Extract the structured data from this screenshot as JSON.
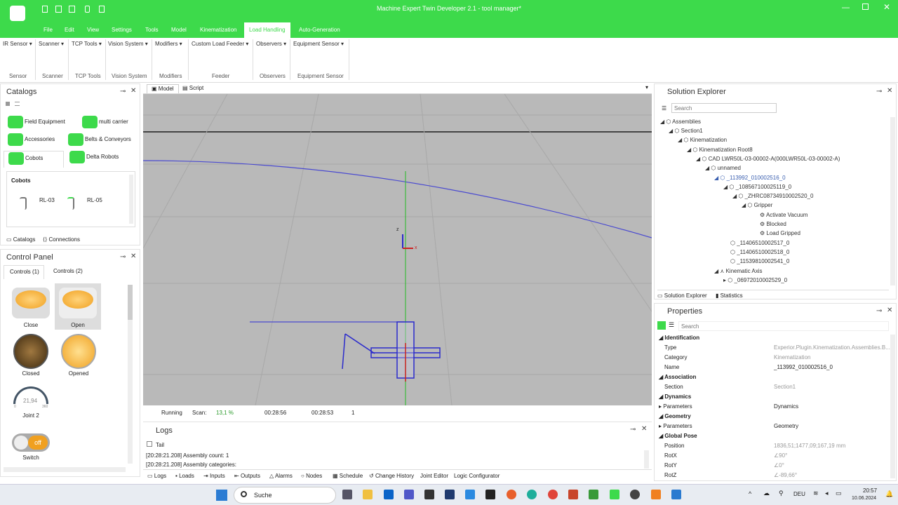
{
  "window": {
    "title": "Machine Expert Twin Developer 2.1 - tool manager*"
  },
  "menu": [
    "File",
    "Edit",
    "View",
    "Settings",
    "Tools",
    "Model",
    "Kinematization",
    "Load Handling",
    "Auto-Generation"
  ],
  "ribbon": {
    "items": [
      "IR Sensor",
      "Scanner",
      "TCP Tools",
      "Vision System",
      "Modifiers",
      "Custom Load Feeder",
      "Observers",
      "Equipment Sensor"
    ],
    "groups": [
      "Sensor",
      "Scanner",
      "TCP Tools",
      "Vision System",
      "Modifiers",
      "Feeder",
      "Observers",
      "Equipment Sensor"
    ]
  },
  "catalogs": {
    "title": "Catalogs",
    "items": [
      "Field Equipment",
      "multi carrier",
      "Accessories",
      "Belts & Conveyors",
      "Cobots",
      "Delta Robots"
    ],
    "section": "Cobots",
    "cobots": [
      "RL-03",
      "RL-05"
    ],
    "tabs": [
      "Catalogs",
      "Connections"
    ]
  },
  "control_panel": {
    "title": "Control Panel",
    "tabs": [
      "Controls (1)",
      "Controls (2)"
    ],
    "controls": [
      "Close",
      "Open",
      "Closed",
      "Opened",
      "Joint 2",
      "Switch"
    ],
    "gauge_value": "21,94",
    "gauge_min": "0",
    "gauge_max": "360",
    "switch_text": "off"
  },
  "viewport": {
    "tabs": [
      "Model",
      "Script"
    ],
    "status": {
      "state": "Running",
      "scan_label": "Scan:",
      "scan_value": "13,1 %",
      "t1": "00:28:56",
      "t2": "00:28:53",
      "count": "1"
    },
    "axis_z": "z",
    "axis_x": "x"
  },
  "logs": {
    "title": "Logs",
    "tail": "Tail",
    "lines": [
      "[20:28:21.208] Assembly count: 1",
      "[20:28:21.208] Assembly categories:"
    ],
    "tabs": [
      "Logs",
      "Loads",
      "Inputs",
      "Outputs",
      "Alarms",
      "Nodes",
      "Schedule",
      "Change History",
      "Joint Editor",
      "Logic Configurator"
    ]
  },
  "solution_explorer": {
    "title": "Solution Explorer",
    "search_placeholder": "Search",
    "tree": [
      "Assemblies",
      "Section1",
      "Kinematization",
      "Kinematization Root8",
      "CAD LWR50L-03-00002-A(000LWR50L-03-00002-A)",
      "unnamed",
      "_113992_010002516_0",
      "_108567100025119_0",
      "_ZHRC08734910002520_0",
      "Gripper",
      "Activate Vacuum",
      "Blocked",
      "Load Gripped",
      "_11406510002517_0",
      "_11406510002518_0",
      "_11539810002541_0",
      "Kinematic Axis",
      "_06972010002529_0"
    ],
    "tabs": [
      "Solution Explorer",
      "Statistics"
    ]
  },
  "properties": {
    "title": "Properties",
    "search_placeholder": "Search",
    "sections": [
      "Identification",
      "Association",
      "Dynamics",
      "Geometry",
      "Global Pose"
    ],
    "rows": [
      {
        "k": "Type",
        "v": "Experior.Plugin.Kinematization.Assemblies.B..."
      },
      {
        "k": "Category",
        "v": "Kinematization"
      },
      {
        "k": "Name",
        "v": "_113992_010002516_0"
      },
      {
        "k": "Section",
        "v": "Section1"
      },
      {
        "k": "Parameters",
        "v": "Dynamics"
      },
      {
        "k": "Parameters",
        "v": "Geometry"
      },
      {
        "k": "Position",
        "v": "1836,51;1477,09;167,19 mm"
      },
      {
        "k": "RotX",
        "v": "∠90°"
      },
      {
        "k": "RotY",
        "v": "∠0°"
      },
      {
        "k": "RotZ",
        "v": "∠-89,66°"
      }
    ]
  },
  "taskbar": {
    "search": "Suche",
    "lang": "DEU",
    "time": "20:57",
    "date": "10.06.2024"
  },
  "colors": {
    "accent": "#3dda4b",
    "viewport": "#b9b9b9"
  }
}
